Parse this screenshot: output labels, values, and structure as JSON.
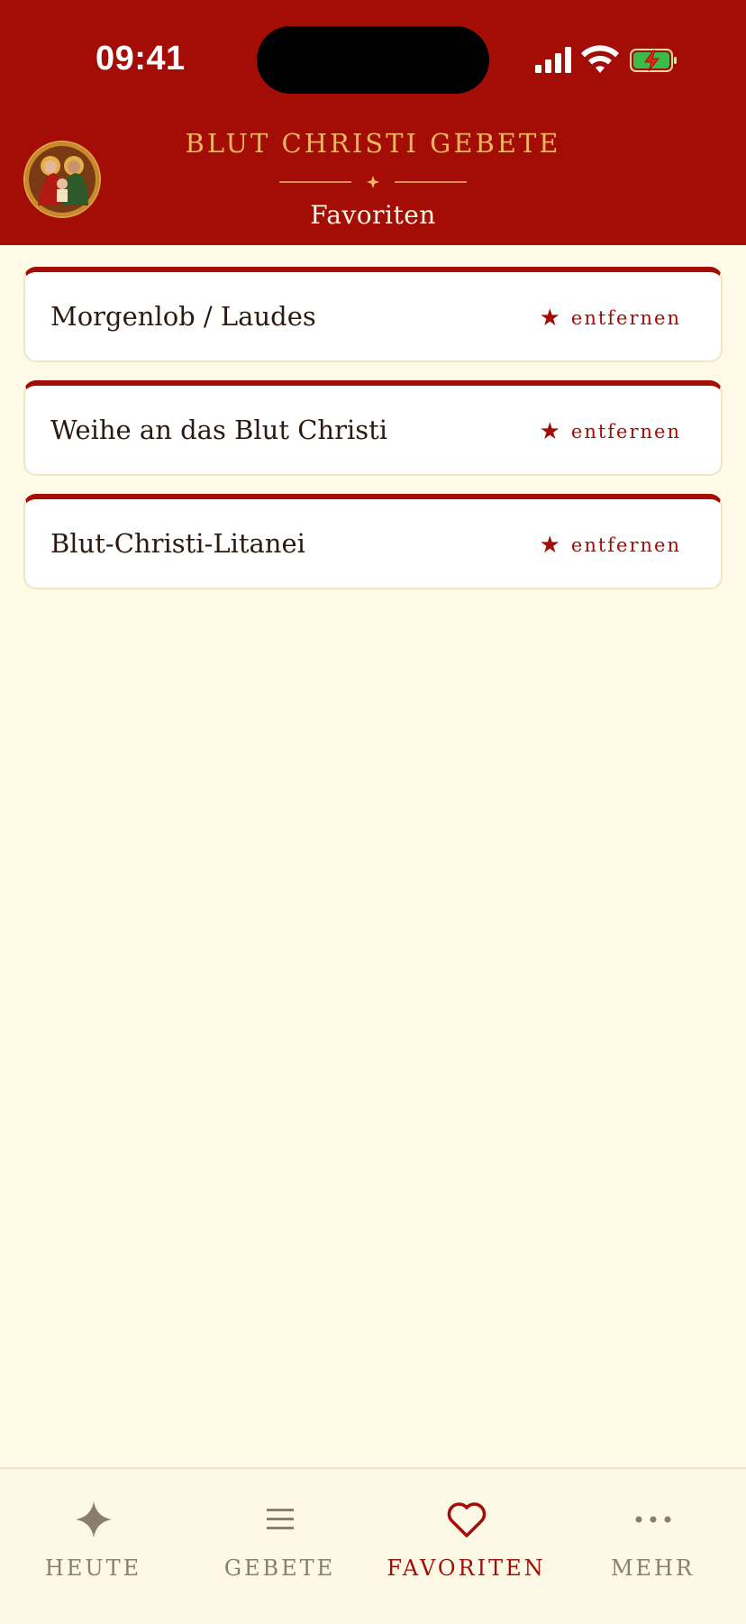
{
  "status_bar": {
    "time": "09:41"
  },
  "header": {
    "app_title": "BLUT CHRISTI GEBETE",
    "subtitle": "Favoriten"
  },
  "favorites": [
    {
      "title": "Morgenlob / Laudes",
      "remove_label": "entfernen"
    },
    {
      "title": "Weihe an das Blut Christi",
      "remove_label": "entfernen"
    },
    {
      "title": "Blut-Christi-Litanei",
      "remove_label": "entfernen"
    }
  ],
  "tabbar": {
    "tabs": [
      {
        "label": "HEUTE",
        "icon": "sparkle-icon",
        "active": false
      },
      {
        "label": "GEBETE",
        "icon": "list-icon",
        "active": false
      },
      {
        "label": "FAVORITEN",
        "icon": "heart-icon",
        "active": true
      },
      {
        "label": "MEHR",
        "icon": "more-icon",
        "active": false
      }
    ]
  },
  "colors": {
    "header_bg": "#a30d06",
    "accent": "#a30d06",
    "gold": "#f0b561",
    "background": "#fefae6",
    "tab_inactive": "#8b7d70"
  }
}
